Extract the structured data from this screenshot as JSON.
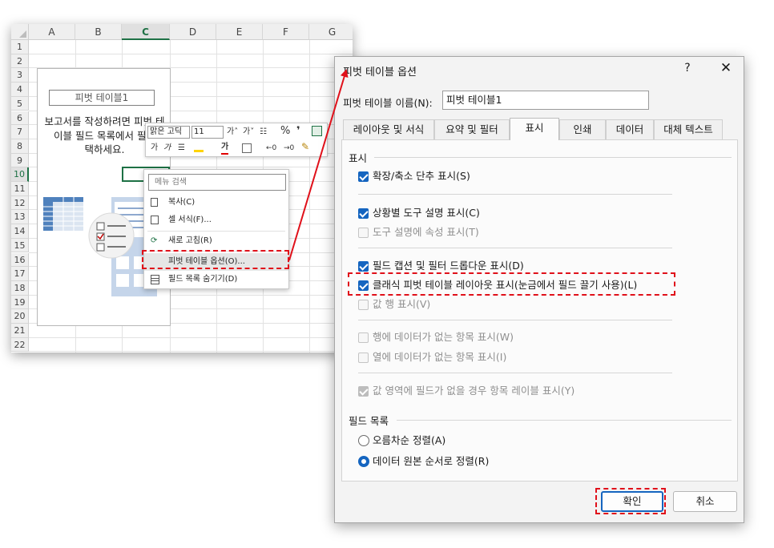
{
  "sheet": {
    "columns": [
      "A",
      "B",
      "C",
      "D",
      "E",
      "F",
      "G"
    ],
    "rows": [
      "1",
      "2",
      "3",
      "4",
      "5",
      "6",
      "7",
      "8",
      "9",
      "10",
      "11",
      "12",
      "13",
      "14",
      "15",
      "16",
      "17",
      "18",
      "19",
      "20",
      "21",
      "22"
    ],
    "pivot_name": "피벗 테이블1",
    "instruction": "보고서를 작성하려면 피벗 테\n이블 필드 목록에서 필드\n택하세요."
  },
  "mini_toolbar": {
    "font": "맑은 고딕",
    "size": "11",
    "row1": [
      "가˄",
      "가˅",
      "☷",
      "%",
      "❜"
    ],
    "row2": [
      "가",
      "가",
      "☰",
      "가"
    ]
  },
  "context_menu": {
    "search_placeholder": "메뉴 검색",
    "items": [
      {
        "label": "복사(C)",
        "icon": "copy-icon"
      },
      {
        "label": "셀 서식(F)...",
        "icon": "format-cells-icon"
      },
      {
        "label": "새로 고침(R)",
        "icon": "refresh-icon"
      },
      {
        "label": "피벗 테이블 옵션(O)...",
        "icon": "pivot-options-icon"
      },
      {
        "label": "필드 목록 숨기기(D)",
        "icon": "field-list-icon"
      }
    ]
  },
  "dialog": {
    "title": "피벗 테이블 옵션",
    "help": "?",
    "close": "✕",
    "name_label": "피벗 테이블 이름(N):",
    "name_value": "피벗 테이블1",
    "tabs": [
      "레이아웃 및 서식",
      "요약 및 필터",
      "표시",
      "인쇄",
      "데이터",
      "대체 텍스트"
    ],
    "active_tab": "표시",
    "group_display": "표시",
    "options": [
      {
        "label": "확장/축소 단추 표시(S)",
        "checked": true,
        "disabled": false
      },
      {
        "label": "상황별 도구 설명 표시(C)",
        "checked": true,
        "disabled": false
      },
      {
        "label": "도구 설명에 속성 표시(T)",
        "checked": false,
        "disabled": true
      },
      {
        "label": "필드 캡션 및 필터 드롭다운 표시(D)",
        "checked": true,
        "disabled": false
      },
      {
        "label": "클래식 피벗 테이블 레이아웃 표시(눈금에서 필드 끌기 사용)(L)",
        "checked": true,
        "disabled": false
      },
      {
        "label": "값 행 표시(V)",
        "checked": false,
        "disabled": true
      },
      {
        "label": "행에 데이터가 없는 항목 표시(W)",
        "checked": false,
        "disabled": true
      },
      {
        "label": "열에 데이터가 없는 항목 표시(I)",
        "checked": false,
        "disabled": true
      },
      {
        "label": "값 영역에 필드가 없을 경우 항목 레이블 표시(Y)",
        "checked": true,
        "disabled": true
      }
    ],
    "group_field_list": "필드 목록",
    "sort_options": [
      {
        "label": "오름차순 정렬(A)",
        "selected": false
      },
      {
        "label": "데이터 원본 순서로 정렬(R)",
        "selected": true
      }
    ],
    "ok": "확인",
    "cancel": "취소"
  },
  "colors": {
    "accent": "#1565c0",
    "annotation": "#e0101a",
    "excel_green": "#1e7145"
  }
}
